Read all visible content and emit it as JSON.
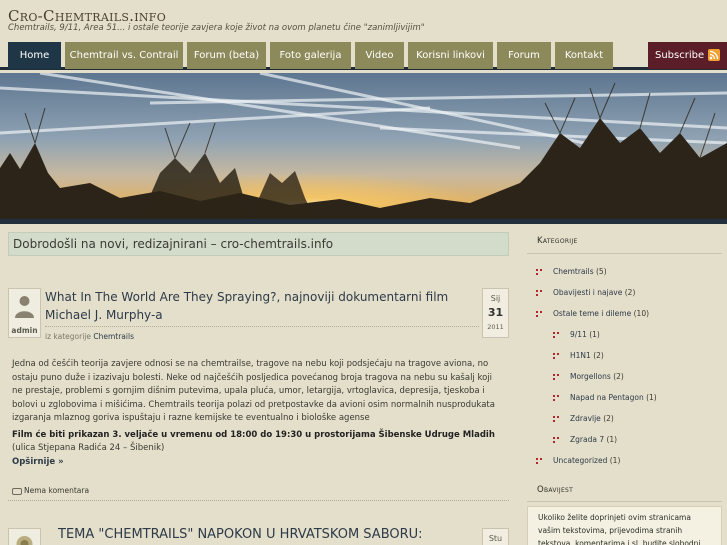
{
  "site": {
    "title": "Cro-Chemtrails.info",
    "description": "Chemtrails, 9/11, Area 51... i ostale teorije zavjera koje život na ovom planetu čine \"zanimljivijim\""
  },
  "nav": {
    "items": [
      "Home",
      "Chemtrail vs. Contrail",
      "Forum (beta)",
      "Foto galerija",
      "Video",
      "Korisni linkovi",
      "Forum",
      "Kontakt"
    ],
    "subscribe": "Subscribe"
  },
  "welcome": "Dobrodošli na novi, redizajnirani – cro-chemtrails.info",
  "posts": [
    {
      "author": "admin",
      "title": "What In The World Are They Spraying?, najnoviji dokumentarni film Michael J. Murphy-a",
      "meta_prefix": "iz kategorije",
      "category": "Chemtrails",
      "date_month": "Sij",
      "date_day": "31",
      "date_year": "2011",
      "body": "Jedna od češćih teorija zavjere odnosi se na chemtrailse, tragove na nebu koji podsjećaju na tragove aviona, no ostaju puno duže i izazivaju bolesti. Neke od najčešćih posljedica povećanog broja tragova na nebu su kašalj koji ne prestaje, problemi s gornjim dišnim putevima, upala pluća, umor, letargija, vrtoglavica, depresija, tjeskoba i bolovi u zglobovima i mišićima. Chemtrails teorija polazi od pretpostavke da avioni osim normalnih nusprodukata izgaranja mlaznog goriva ispuštaju i razne kemijske te eventualno i biološke agense",
      "event_bold": "Film će biti prikazan  3. veljače u vremenu od 18:00 do 19:30  u prostorijama Šibenske Udruge Mladih",
      "event_rest": " (ulica Stjepana Radića 24 – Šibenik)",
      "read_more": "Opširnije »",
      "comments": "Nema komentara"
    },
    {
      "title": "TEMA \"CHEMTRAILS\" NAPOKON U HRVATSKOM SABORU:",
      "date_month": "Stu"
    }
  ],
  "sidebar": {
    "categories_title": "Kategorije",
    "categories": [
      {
        "name": "Chemtrails",
        "count": "(5)",
        "level": 0
      },
      {
        "name": "Obavijesti i najave",
        "count": "(2)",
        "level": 0
      },
      {
        "name": "Ostale teme i dileme",
        "count": "(10)",
        "level": 0
      },
      {
        "name": "9/11",
        "count": "(1)",
        "level": 1
      },
      {
        "name": "H1N1",
        "count": "(2)",
        "level": 1
      },
      {
        "name": "Morgellons",
        "count": "(2)",
        "level": 1
      },
      {
        "name": "Napad na Pentagon",
        "count": "(1)",
        "level": 1
      },
      {
        "name": "Zdravlje",
        "count": "(2)",
        "level": 1
      },
      {
        "name": "Zgrada 7",
        "count": "(1)",
        "level": 1
      },
      {
        "name": "Uncategorized",
        "count": "(1)",
        "level": 0
      }
    ],
    "notice_title": "Obavijest",
    "notice_text": "Ukoliko želite doprinjeti ovim stranicama vašim tekstovima, prijevodima stranih tekstova, komentarima i sl. budite slobodni kontaktirati"
  },
  "colors": {
    "nav_active": "#1f3646",
    "nav_bg": "#8c8a5a",
    "subscribe_bg": "#5b1e28",
    "accent_red": "#b3262f",
    "link": "#2d3a48"
  }
}
